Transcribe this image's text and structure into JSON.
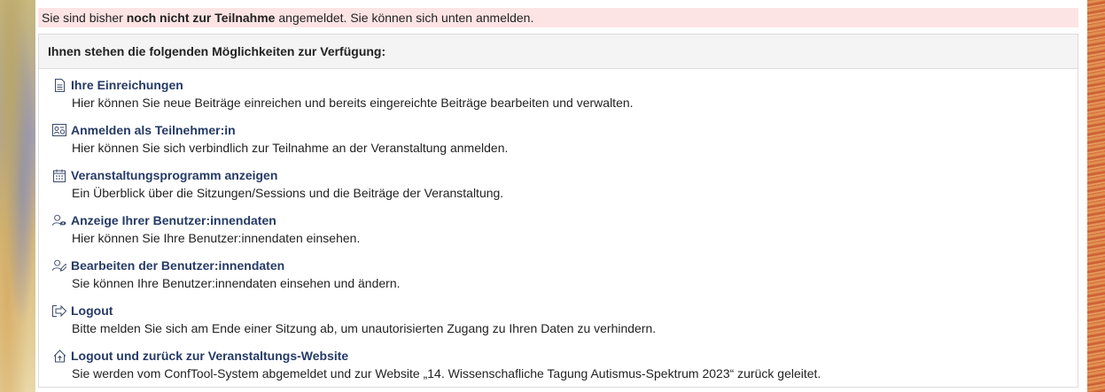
{
  "notice": {
    "prefix": "Sie sind bisher ",
    "bold": "noch nicht zur Teilnahme",
    "suffix": " angemeldet. Sie können sich unten anmelden."
  },
  "panel": {
    "title": "Ihnen stehen die folgenden Möglichkeiten zur Verfügung:"
  },
  "items": [
    {
      "icon": "document-icon",
      "title": "Ihre Einreichungen",
      "desc": "Hier können Sie neue Beiträge einreichen und bereits eingereichte Beiträge bearbeiten und verwalten."
    },
    {
      "icon": "id-card-icon",
      "title": "Anmelden als Teilnehmer:in",
      "desc": "Hier können Sie sich verbindlich zur Teilnahme an der Veranstaltung anmelden."
    },
    {
      "icon": "calendar-icon",
      "title": "Veranstaltungsprogramm anzeigen",
      "desc": "Ein Überblick über die Sitzungen/Sessions und die Beiträge der Veranstaltung."
    },
    {
      "icon": "user-view-icon",
      "title": "Anzeige Ihrer Benutzer:innendaten",
      "desc": "Hier können Sie Ihre Benutzer:innendaten einsehen."
    },
    {
      "icon": "user-edit-icon",
      "title": "Bearbeiten der Benutzer:innendaten",
      "desc": "Sie können Ihre Benutzer:innendaten einsehen und ändern."
    },
    {
      "icon": "logout-icon",
      "title": "Logout",
      "desc": "Bitte melden Sie sich am Ende einer Sitzung ab, um unautorisierten Zugang zu Ihren Daten zu verhindern."
    },
    {
      "icon": "home-logout-icon",
      "title": "Logout und zurück zur Veranstaltungs-Website",
      "desc": "Sie werden vom ConfTool-System abgemeldet und zur Website „14. Wissenschafliche Tagung Autismus-Spektrum 2023“ zurück geleitet."
    }
  ]
}
